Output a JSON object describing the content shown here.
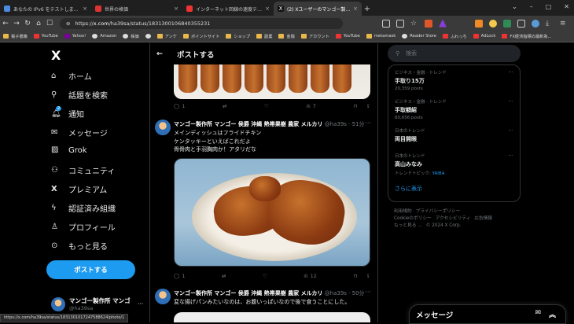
{
  "browser": {
    "tabs": [
      {
        "title": "あなたの IPv6 をテストしましょう。",
        "color": "#4a8be0"
      },
      {
        "title": "世界の格価",
        "color": "#d33"
      },
      {
        "title": "インターネット回線の速度テスト | Fast.com",
        "color": "#e33"
      },
      {
        "title": "(2) Xユーザーのマンゴー製作所 マンゴ",
        "color": "#eee",
        "active": true
      }
    ],
    "url_prefix": "https://",
    "url_domain": "x.com",
    "url_path": "/ha39sa/status/1831300106840355231",
    "bookmarks": [
      "電子書籍",
      "YouTube",
      "Yahoo!",
      "Amazon",
      "株価",
      "",
      "アンケ",
      "ポイントサイト",
      "ショップ",
      "副業",
      "金融",
      "アカウント",
      "YouTube",
      "metamask",
      "Reader Store",
      "ふわっち",
      "AdLock",
      "FX経済指標の最新為..."
    ],
    "status_url": "https://x.com/ha39sa/status/1831301017247588624/photo/1"
  },
  "nav": {
    "logo": "X",
    "items": [
      "ホーム",
      "話題を検索",
      "通知",
      "メッセージ",
      "Grok",
      "コミュニティ",
      "プレミアム",
      "認証済み組織",
      "プロフィール",
      "もっと見る"
    ],
    "notif_badge": "2",
    "post_button": "ポストする",
    "account_name": "マンゴー製作所 マンゴ",
    "account_handle": "@ha39sa"
  },
  "header": {
    "back": "←",
    "title": "ポストする"
  },
  "tweet1_actions": {
    "replies": "1",
    "retweets": "",
    "likes": "",
    "views": "7"
  },
  "tweet2": {
    "name": "マンゴー製作所 マンゴー 侯爵 沖縄 熱帯果樹 農家 メルカリ",
    "handle": "@ha39s · 51分",
    "lines": [
      "メインディッシュはフライドチキン",
      "ケンタッキーといえばこれだよ",
      "骨骨肉と手羽胸肉か！アタリだな"
    ],
    "replies": "1",
    "retweets": "",
    "likes": "",
    "views": "12"
  },
  "tweet3": {
    "name": "マンゴー製作所 マンゴー 侯爵 沖縄 熱帯果樹 農家 メルカリ",
    "handle": "@ha39s · 50分",
    "line": "変な揚げパンみたいなのは、お腹いっぱいなので後で食うことにした。"
  },
  "search_placeholder": "検索",
  "trends": [
    {
      "category": "ビジネス・金融 · トレンド",
      "title": "手取り15万",
      "count": "20,359 posts"
    },
    {
      "category": "ビジネス・金融 · トレンド",
      "title": "手取額紹",
      "count": "80,656 posts"
    },
    {
      "category": "日本のトレンド",
      "title": "両目開眼",
      "count": ""
    },
    {
      "category": "日本のトレンド",
      "title": "高山みなみ",
      "count": "トレンドトピック: ",
      "link": "YAIBA"
    }
  ],
  "show_more": "さらに表示",
  "footer": [
    "利用規約",
    "プライバシーポリシー",
    "Cookieのポリシー",
    "アクセシビリティ",
    "広告情報",
    "もっと見る …",
    "© 2024 X Corp."
  ],
  "messages_title": "メッセージ"
}
